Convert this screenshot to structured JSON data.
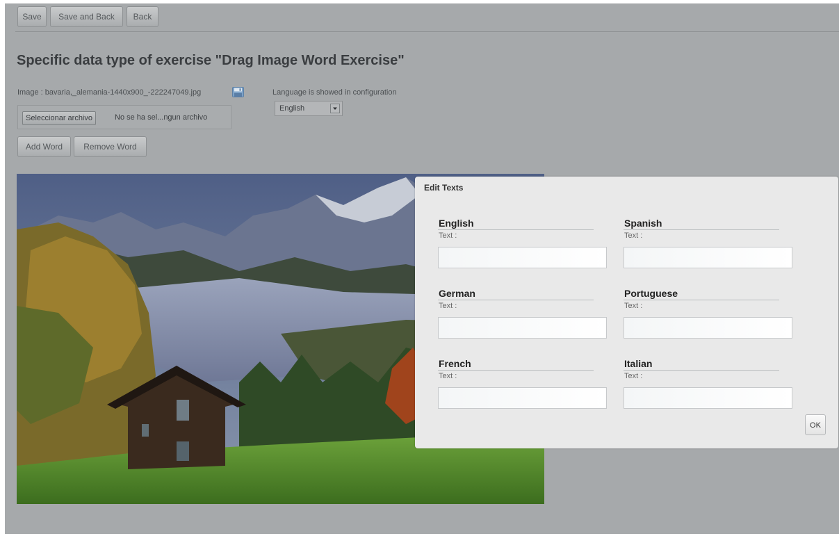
{
  "toolbar": {
    "save_label": "Save",
    "save_back_label": "Save and Back",
    "back_label": "Back"
  },
  "page_title": "Specific data type of exercise \"Drag Image Word Exercise\"",
  "image": {
    "label": "Image : bavaria,_alemania-1440x900_-222247049.jpg",
    "save_icon": "floppy-disk-icon"
  },
  "file_input": {
    "button_label": "Seleccionar archivo",
    "status": "No se ha sel...ngun archivo"
  },
  "language": {
    "label": "Language is showed in configuration",
    "selected": "English"
  },
  "word_buttons": {
    "add_label": "Add Word",
    "remove_label": "Remove Word"
  },
  "dialog": {
    "title": "Edit Texts",
    "field_label": "Text :",
    "languages": [
      "English",
      "Spanish",
      "German",
      "Portuguese",
      "French",
      "Italian"
    ],
    "ok_label": "OK"
  }
}
